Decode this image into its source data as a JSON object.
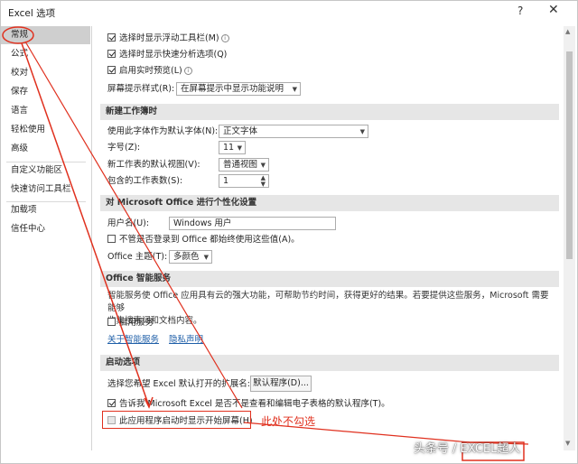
{
  "window": {
    "title": "Excel 选项",
    "help": "?",
    "close": "✕"
  },
  "sidebar": {
    "items": [
      "常规",
      "公式",
      "校对",
      "保存",
      "语言",
      "轻松使用",
      "高级",
      "自定义功能区",
      "快速访问工具栏",
      "加载项",
      "信任中心"
    ],
    "selected": "常规"
  },
  "ui_options": {
    "mini_toolbar": "选择时显示浮动工具栏(M)",
    "quick_analysis": "选择时显示快速分析选项(Q)",
    "live_preview": "启用实时预览(L)",
    "screentip_label": "屏幕提示样式(R):",
    "screentip_value": "在屏幕提示中显示功能说明"
  },
  "new_workbook": {
    "header": "新建工作簿时",
    "font_label": "使用此字体作为默认字体(N):",
    "font_value": "正文字体",
    "size_label": "字号(Z):",
    "size_value": "11",
    "view_label": "新工作表的默认视图(V):",
    "view_value": "普通视图",
    "sheets_label": "包含的工作表数(S):",
    "sheets_value": "1"
  },
  "personalize": {
    "header": "对 Microsoft Office 进行个性化设置",
    "username_label": "用户名(U):",
    "username_value": "Windows 用户",
    "always_use": "不管是否登录到 Office 都始终使用这些值(A)。",
    "theme_label": "Office 主题(T):",
    "theme_value": "多颜色"
  },
  "intelligent": {
    "header": "Office 智能服务",
    "desc_line1": "智能服务使 Office 应用具有云的强大功能，可帮助节约时间，获得更好的结果。若要提供这些服务，Microsoft 需要能够",
    "desc_line2": "收集搜索词和文档内容。",
    "enable": "启用服务",
    "about_link": "关于智能服务",
    "privacy_link": "隐私声明"
  },
  "startup": {
    "header": "启动选项",
    "extensions_label": "选择您希望 Excel 默认打开的扩展名:",
    "default_programs_button": "默认程序(D)...",
    "tell_me": "告诉我 Microsoft Excel 是否不是查看和编辑电子表格的默认程序(T)。",
    "show_start_screen": "此应用程序启动时显示开始屏幕(H)"
  },
  "annotation": "此处不勾选",
  "watermark": "头条号 / EXCEL超人",
  "colors": {
    "annotation_red": "#e0301e",
    "section_bg": "#e6e6e6",
    "selected_nav": "#cfcfcf",
    "link_blue": "#1f5fa8"
  }
}
